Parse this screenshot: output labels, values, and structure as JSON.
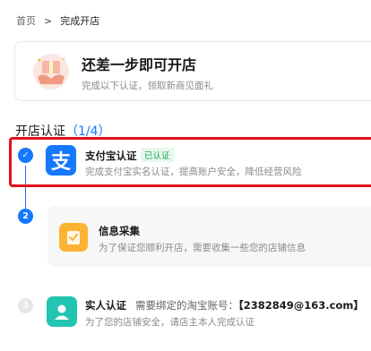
{
  "breadcrumb": {
    "home": "首页",
    "separator": ">",
    "current": "完成开店"
  },
  "hero": {
    "title": "还差一步即可开店",
    "subtitle": "完成以下认证，领取新商见面礼"
  },
  "section": {
    "title": "开店认证",
    "progress_open": "（",
    "progress": "1/4",
    "progress_close": "）"
  },
  "steps": [
    {
      "index": "✓",
      "icon": "alipay-icon",
      "icon_glyph": "支",
      "title": "支付宝认证",
      "badge": "已认证",
      "desc": "完成支付宝实名认证，提高账户安全，降低经营风险",
      "status": "done"
    },
    {
      "index": "2",
      "icon": "clipboard-check-icon",
      "title": "信息采集",
      "desc": "为了保证您顺利开店，需要收集一些您的店铺信息",
      "status": "current"
    },
    {
      "index": "3",
      "icon": "person-icon",
      "title": "实人认证",
      "account_label": "需要绑定的淘宝账号：",
      "account_value": "【2382849@163.com】",
      "desc": "为了您的店铺安全，请店主本人完成认证",
      "status": "pending"
    }
  ],
  "colors": {
    "accent": "#1677ff",
    "highlight": "#e3101d",
    "success": "#19a94f"
  }
}
